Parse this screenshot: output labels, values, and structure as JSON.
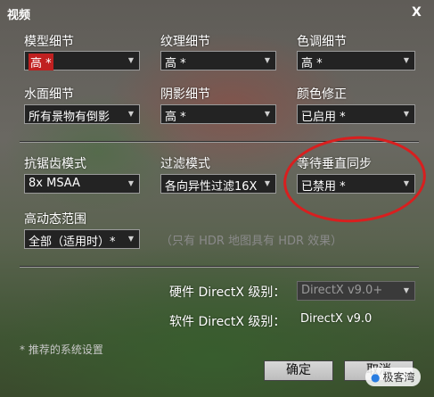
{
  "window": {
    "title": "视频",
    "close_label": "X"
  },
  "settings": {
    "model_detail": {
      "label": "模型细节",
      "value": "高 *"
    },
    "texture_detail": {
      "label": "纹理细节",
      "value": "高 *"
    },
    "shade_detail": {
      "label": "色调细节",
      "value": "高 *"
    },
    "water_detail": {
      "label": "水面细节",
      "value": "所有景物有倒影"
    },
    "shadow_detail": {
      "label": "阴影细节",
      "value": "高 *"
    },
    "color_correction": {
      "label": "颜色修正",
      "value": "已启用 *"
    },
    "antialiasing": {
      "label": "抗锯齿模式",
      "value": "8x MSAA"
    },
    "filtering": {
      "label": "过滤模式",
      "value": "各向异性过滤16X"
    },
    "vsync": {
      "label": "等待垂直同步",
      "value": "已禁用 *"
    },
    "hdr": {
      "label": "高动态范围",
      "value": "全部（适用时）*"
    }
  },
  "hdr_hint": "（只有 HDR 地图具有 HDR 效果）",
  "directx": {
    "hardware_label": "硬件 DirectX 级别：",
    "hardware_value": "DirectX v9.0+",
    "software_label": "软件 DirectX 级别：",
    "software_value": "DirectX v9.0"
  },
  "footnote": "* 推荐的系统设置",
  "buttons": {
    "ok": "确定",
    "cancel": "取消"
  },
  "watermark": "极客湾",
  "colors": {
    "highlight_ring": "#d81f1f",
    "combo_bg": "#232323"
  }
}
